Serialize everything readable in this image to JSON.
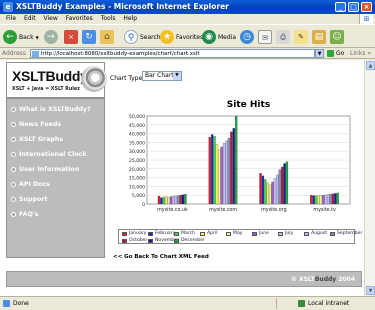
{
  "window": {
    "title": "XSLTBuddy Examples - Microsoft Internet Explorer"
  },
  "menu": [
    "File",
    "Edit",
    "View",
    "Favorites",
    "Tools",
    "Help"
  ],
  "toolbar": {
    "back_label": "Back",
    "search_label": "Search",
    "favorites_label": "Favorites",
    "media_label": "Media"
  },
  "address": {
    "label": "Address",
    "url": "http://localhost:8080/xsltbuddy-examples/chart/chart.xslt",
    "go_label": "Go",
    "links_label": "Links"
  },
  "logo": {
    "title": "XSLTBuddy",
    "subtitle": "XSLT + Java = XSLT Rulez"
  },
  "nav": [
    "What is XSLTBuddy?",
    "News Feeds",
    "XSLT Graphs",
    "International Clock",
    "User Information",
    "API Docs",
    "Support",
    "FAQ's"
  ],
  "chart_type": {
    "label": "Chart Type:",
    "selected": "Bar Chart"
  },
  "back_link": "<< Go Back To Chart XML Feed",
  "footer": {
    "copyright_prefix": "© XSLT",
    "copyright_brand": "Buddy",
    "copyright_year": " 2004"
  },
  "status": {
    "left": "Done",
    "right": "Local intranet"
  },
  "colors": {
    "January": "#d81b3c",
    "February": "#1c2fa8",
    "March": "#3cd85a",
    "April": "#fbf25a",
    "May": "#f7f2a0",
    "June": "#a05ad8",
    "July": "#c8c0f0",
    "August": "#b8b8ff",
    "September": "#8c8ca8",
    "October": "#a81c4a",
    "November": "#1c1c8c",
    "December": "#18a83c"
  },
  "chart_data": {
    "type": "bar",
    "title": "Site Hits",
    "categories": [
      "mysite.co.uk",
      "mysite.com",
      "mysite.org",
      "mysite.tv"
    ],
    "ylim": [
      0,
      50000
    ],
    "yticks": [
      "0",
      "5,000",
      "10,000",
      "15,000",
      "20,000",
      "25,000",
      "30,000",
      "35,000",
      "40,000",
      "45,000",
      "50,000"
    ],
    "grid": true,
    "legend": "bottom",
    "series": [
      {
        "name": "January",
        "values": [
          4500,
          38000,
          17500,
          5000
        ]
      },
      {
        "name": "February",
        "values": [
          3500,
          39500,
          16000,
          4800
        ]
      },
      {
        "name": "March",
        "values": [
          4000,
          38500,
          14000,
          4600
        ]
      },
      {
        "name": "April",
        "values": [
          4200,
          34000,
          12000,
          4700
        ]
      },
      {
        "name": "May",
        "values": [
          3800,
          31000,
          11000,
          4900
        ]
      },
      {
        "name": "June",
        "values": [
          4100,
          32500,
          12500,
          5000
        ]
      },
      {
        "name": "July",
        "values": [
          4400,
          34500,
          14500,
          5200
        ]
      },
      {
        "name": "August",
        "values": [
          4600,
          36000,
          16500,
          5400
        ]
      },
      {
        "name": "September",
        "values": [
          4800,
          37500,
          19500,
          5600
        ]
      },
      {
        "name": "October",
        "values": [
          5000,
          41000,
          21000,
          5800
        ]
      },
      {
        "name": "November",
        "values": [
          5300,
          43000,
          23000,
          6000
        ]
      },
      {
        "name": "December",
        "values": [
          5500,
          50000,
          24000,
          6300
        ]
      }
    ]
  }
}
